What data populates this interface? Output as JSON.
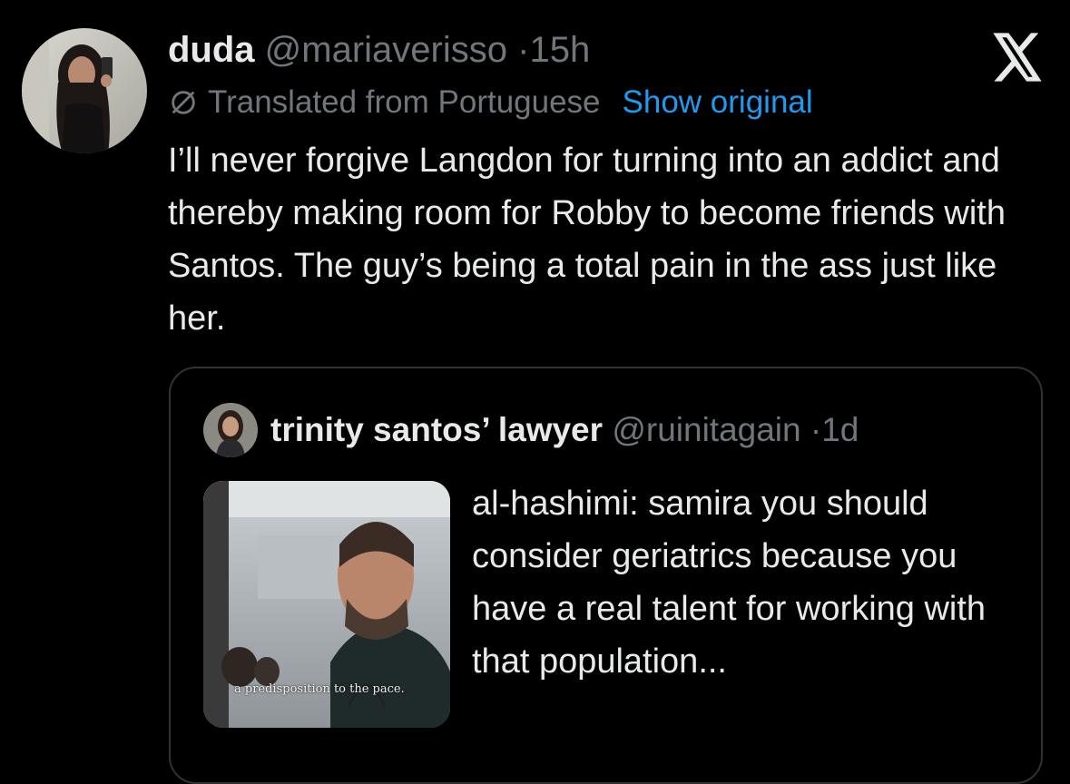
{
  "tweet": {
    "display_name": "duda",
    "handle": "@mariaverisso",
    "separator": "·",
    "time": "15h",
    "translated_label": "Translated from Portuguese",
    "show_original": "Show original",
    "text": "I’ll never forgive Langdon for turning into an addict and thereby making room for Robby to become friends with Santos. The guy’s being a total pain in the ass just like her."
  },
  "quote": {
    "display_name": "trinity santos’ lawyer",
    "handle": "@ruinitagain",
    "separator": "·",
    "time": "1d",
    "text": "al-hashimi: samira you should consider geriatrics because you have a real talent for working with that population...",
    "media_caption": "a predisposition to the pace."
  },
  "colors": {
    "background": "#000000",
    "text": "#e7e9ea",
    "muted": "#71767b",
    "link": "#1d9bf0",
    "border": "#2f3336"
  }
}
